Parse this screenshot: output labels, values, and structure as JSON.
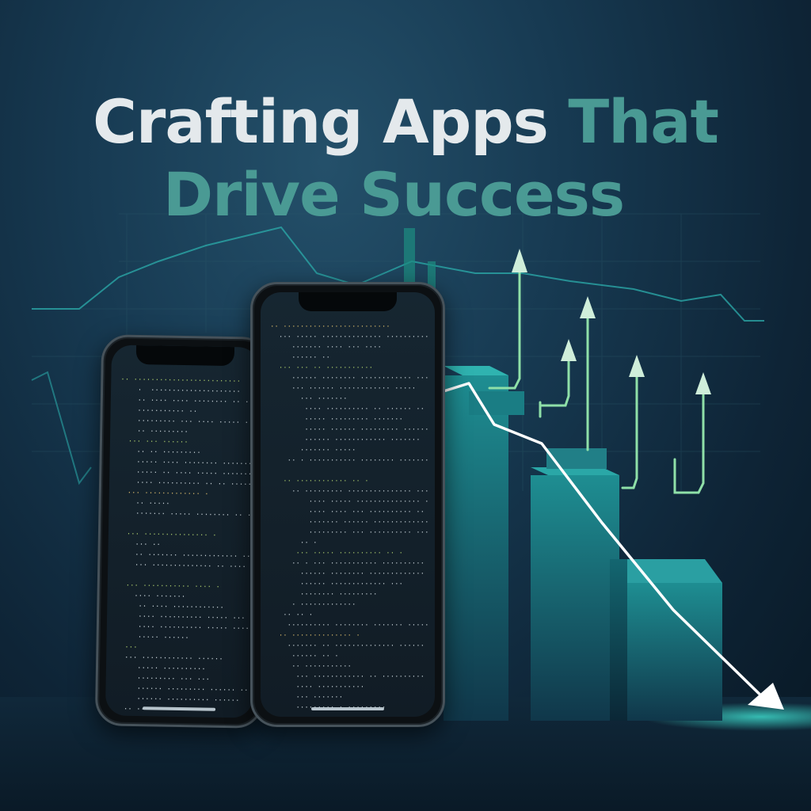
{
  "headline": {
    "line1_white": "Crafting Apps",
    "line1_teal": "That",
    "line2": "Drive Success"
  },
  "colors": {
    "headline_white": "#e4e9ec",
    "headline_teal": "#4a9a94",
    "accent_green": "#7fd39a",
    "bar_teal": "#1f8f93",
    "arrow_white": "#ffffff"
  },
  "icons": [
    "smartphone-icon",
    "up-arrow-icon",
    "down-trend-arrow-icon"
  ]
}
